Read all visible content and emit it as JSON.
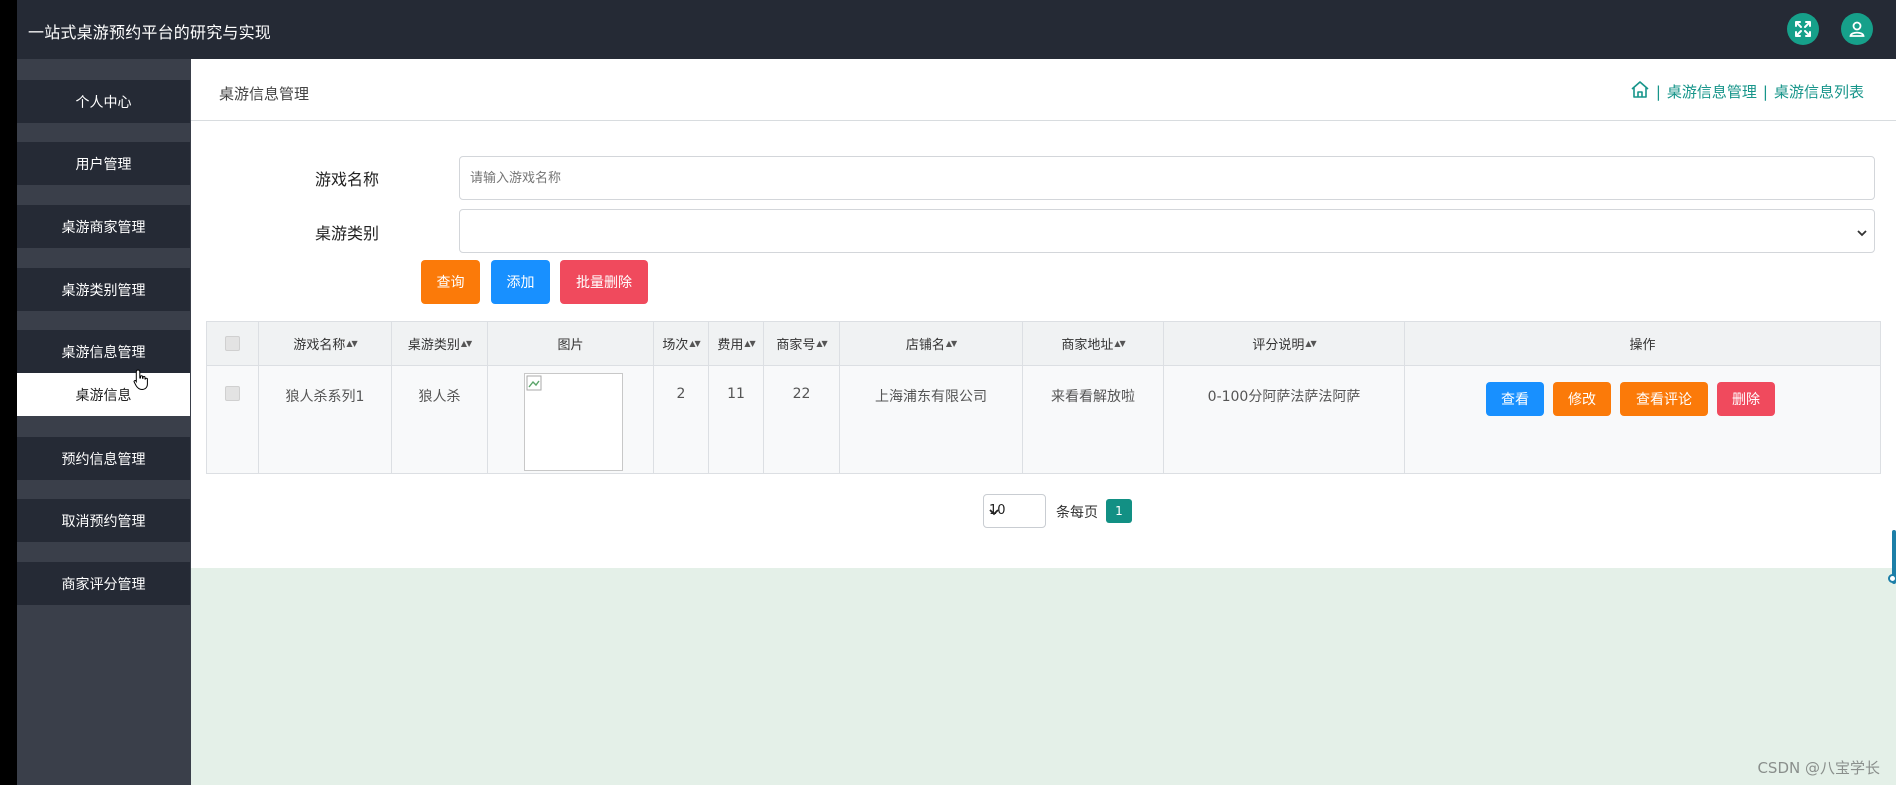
{
  "app": {
    "title": "一站式桌游预约平台的研究与实现"
  },
  "topbar": {
    "fullscreen_icon": "expand-icon",
    "user_icon": "user-icon",
    "accent": "#16a08a"
  },
  "sidebar": {
    "items": [
      {
        "label": "个人中心"
      },
      {
        "label": "用户管理"
      },
      {
        "label": "桌游商家管理"
      },
      {
        "label": "桌游类别管理"
      },
      {
        "label": "桌游信息管理"
      },
      {
        "label": "预约信息管理"
      },
      {
        "label": "取消预约管理"
      },
      {
        "label": "商家评分管理"
      }
    ],
    "sub_item": {
      "label": "桌游信息"
    }
  },
  "page": {
    "title": "桌游信息管理",
    "breadcrumb": {
      "home_icon": "home-icon",
      "sep": "|",
      "crumb1": "桌游信息管理",
      "crumb2": "桌游信息列表"
    }
  },
  "search": {
    "name_label": "游戏名称",
    "name_placeholder": "请输入游戏名称",
    "category_label": "桌游类别",
    "category_value": "",
    "buttons": {
      "query": "查询",
      "add": "添加",
      "batch_delete": "批量删除"
    }
  },
  "table": {
    "headers": [
      "游戏名称",
      "桌游类别",
      "图片",
      "场次",
      "费用",
      "商家号",
      "店铺名",
      "商家地址",
      "评分说明",
      "操作"
    ],
    "sort_icon": "sort-icon",
    "rows": [
      {
        "name": "狼人杀系列1",
        "category": "狼人杀",
        "image": "broken-image-icon",
        "sessions": "2",
        "fee": "11",
        "merchant_no": "22",
        "shop": "上海浦东有限公司",
        "address": "来看看解放啦",
        "rating_desc": "0-100分阿萨法萨法阿萨",
        "actions": {
          "view": "查看",
          "edit": "修改",
          "view_comments": "查看评论",
          "delete": "删除"
        }
      }
    ]
  },
  "pagination": {
    "page_size": "10",
    "per_page_label": "条每页",
    "current_page": "1"
  },
  "colors": {
    "orange": "#fb7a09",
    "blue": "#1890ff",
    "red": "#f04a5d",
    "teal": "#129084"
  },
  "watermark": "CSDN @八宝学长"
}
